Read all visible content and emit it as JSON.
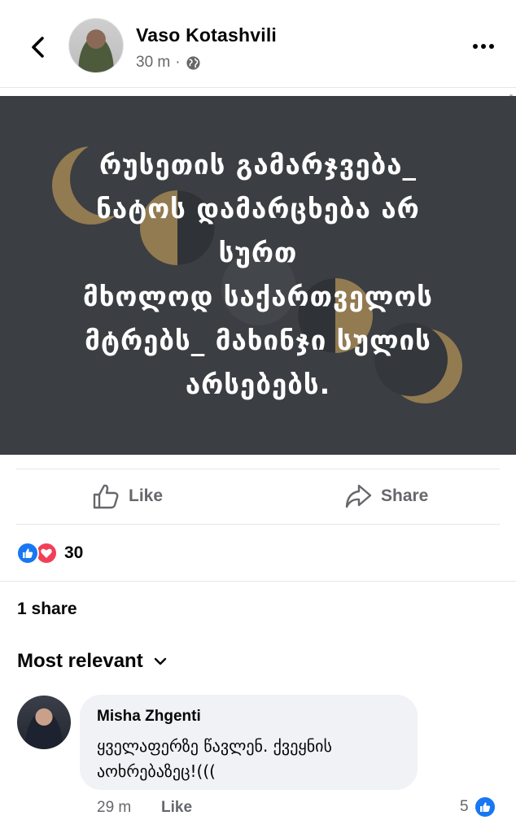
{
  "header": {
    "author_name": "Vaso Kotashvili",
    "time_ago": "30 m",
    "separator": "·",
    "audience_icon": "globe-icon",
    "back_icon": "chevron-left-icon",
    "more_icon": "more-horizontal-icon"
  },
  "post": {
    "text_lines": "რუსეთის გამარჯვება_\nნატოს დამარცხება არ\nსურთ\nმხოლოდ საქართველოს\nმტრებს_ მახინჯი სულის\nარსებებს.",
    "background_color": "#3b3e42",
    "text_color": "#ffffff",
    "accent_color": "#9c8253"
  },
  "actions": {
    "like_label": "Like",
    "share_label": "Share",
    "like_icon": "thumbs-up-outline-icon",
    "share_icon": "share-arrow-icon"
  },
  "reactions": {
    "count": "30",
    "types": [
      "like",
      "love"
    ],
    "like_color": "#1877f2",
    "love_color": "#f33e58"
  },
  "shares": {
    "label": "1 share"
  },
  "comments": {
    "sort_label": "Most relevant",
    "sort_icon": "chevron-down-icon",
    "items": [
      {
        "author": "Misha Zhgenti",
        "text": "ყველაფერზე წავლენ. ქვეყნის აოხრებაზეც!(((",
        "time_ago": "29 m",
        "like_label": "Like",
        "reaction_count": "5"
      }
    ]
  }
}
